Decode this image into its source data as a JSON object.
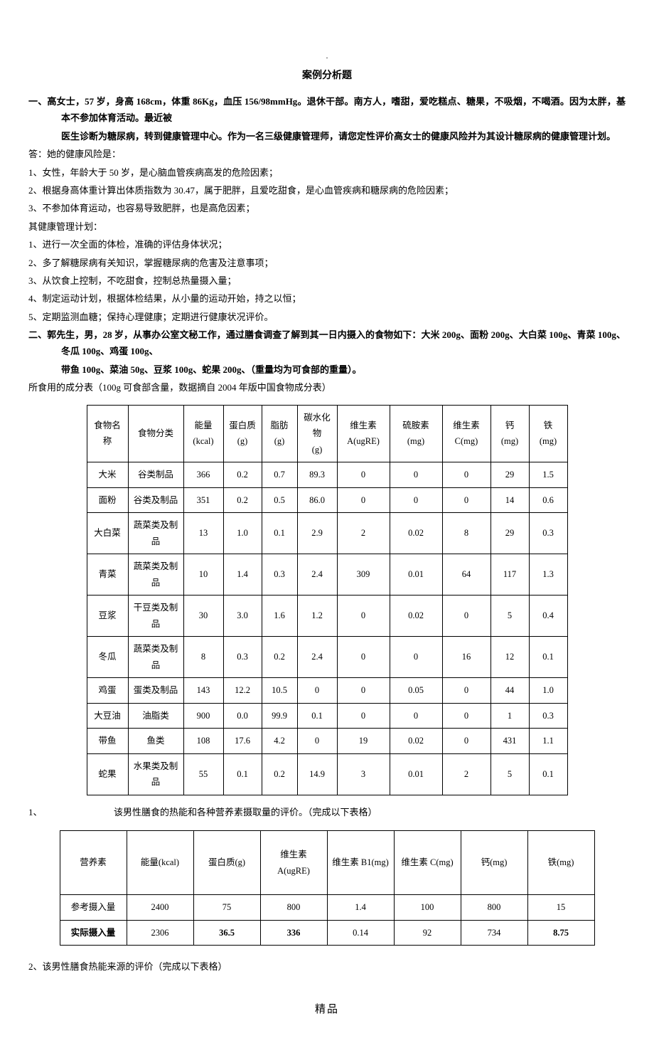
{
  "header_dot": ".",
  "title": "案例分析题",
  "q1": {
    "stem1": "一、高女士，57 岁，身高 168cm，体重 86Kg，血压 156/98mmHg。退休干部。南方人，嗜甜，爱吃糕点、糖果，不吸烟，不喝酒。因为太胖，基本不参加体育活动。最近被",
    "stem2": "医生诊断为糖尿病，转到健康管理中心。作为一名三级健康管理师，请您定性评价高女士的健康风险并为其设计糖尿病的健康管理计划。",
    "ans_label": "答：她的健康风险是：",
    "r1": "1、女性，年龄大于 50 岁，是心脑血管疾病高发的危险因素；",
    "r2": "2、根据身高体重计算出体质指数为 30.47，属于肥胖，且爱吃甜食，是心血管疾病和糖尿病的危险因素；",
    "r3": "3、不参加体育运动，也容易导致肥胖，也是高危因素；",
    "plan_label": "其健康管理计划：",
    "p1": "1、进行一次全面的体检，准确的评估身体状况；",
    "p2": "2、多了解糖尿病有关知识，掌握糖尿病的危害及注意事项；",
    "p3": "3、从饮食上控制，不吃甜食，控制总热量摄入量；",
    "p4": "4、制定运动计划，根据体检结果，从小量的运动开始，持之以恒；",
    "p5": "5、定期监测血糖；保持心理健康；定期进行健康状况评价。"
  },
  "q2": {
    "stem1": "二、郭先生，男，28 岁，从事办公室文秘工作，通过膳食调查了解到其一日内摄入的食物如下：大米 200g、面粉 200g、大白菜 100g、青菜 100g、冬瓜 100g、鸡蛋 100g、",
    "stem2": "带鱼 100g、菜油 50g、豆浆 100g、蛇果 200g、（重量均为可食部的重量）。",
    "note": "所食用的成分表（100g 可食部含量，数据摘自 2004 年版中国食物成分表）"
  },
  "t1": {
    "headers": [
      "食物名称",
      "食物分类",
      "能量\n(kcal)",
      "蛋白质(g)",
      "脂肪\n(g)",
      "碳水化物\n(g)",
      "维生素\nA(ugRE)",
      "硫胺素\n(mg)",
      "维生素\nC(mg)",
      "钙\n(mg)",
      "铁\n(mg)"
    ],
    "rows": [
      [
        "大米",
        "谷类制品",
        "366",
        "0.2",
        "0.7",
        "89.3",
        "0",
        "0",
        "0",
        "29",
        "1.5"
      ],
      [
        "面粉",
        "谷类及制品",
        "351",
        "0.2",
        "0.5",
        "86.0",
        "0",
        "0",
        "0",
        "14",
        "0.6"
      ],
      [
        "大白菜",
        "蔬菜类及制品",
        "13",
        "1.0",
        "0.1",
        "2.9",
        "2",
        "0.02",
        "8",
        "29",
        "0.3"
      ],
      [
        "青菜",
        "蔬菜类及制品",
        "10",
        "1.4",
        "0.3",
        "2.4",
        "309",
        "0.01",
        "64",
        "117",
        "1.3"
      ],
      [
        "豆浆",
        "干豆类及制品",
        "30",
        "3.0",
        "1.6",
        "1.2",
        "0",
        "0.02",
        "0",
        "5",
        "0.4"
      ],
      [
        "冬瓜",
        "蔬菜类及制品",
        "8",
        "0.3",
        "0.2",
        "2.4",
        "0",
        "0",
        "16",
        "12",
        "0.1"
      ],
      [
        "鸡蛋",
        "蛋类及制品",
        "143",
        "12.2",
        "10.5",
        "0",
        "0",
        "0.05",
        "0",
        "44",
        "1.0"
      ],
      [
        "大豆油",
        "油脂类",
        "900",
        "0.0",
        "99.9",
        "0.1",
        "0",
        "0",
        "0",
        "1",
        "0.3"
      ],
      [
        "带鱼",
        "鱼类",
        "108",
        "17.6",
        "4.2",
        "0",
        "19",
        "0.02",
        "0",
        "431",
        "1.1"
      ],
      [
        "蛇果",
        "水果类及制品",
        "55",
        "0.1",
        "0.2",
        "14.9",
        "3",
        "0.01",
        "2",
        "5",
        "0.1"
      ]
    ]
  },
  "sub1": {
    "num": "1、",
    "text": "该男性膳食的热能和各种营养素摄取量的评价。（完成以下表格）"
  },
  "t2": {
    "headers": [
      "营养素",
      "能量(kcal)",
      "蛋白质(g)",
      "维生素\nA(ugRE)",
      "维生素 B1(mg)",
      "维生素 C(mg)",
      "钙(mg)",
      "铁(mg)"
    ],
    "rows": [
      [
        "参考摄入量",
        "2400",
        "75",
        "800",
        "1.4",
        "100",
        "800",
        "15"
      ],
      [
        "实际摄入量",
        "2306",
        "36.5",
        "336",
        "0.14",
        "92",
        "734",
        "8.75"
      ]
    ]
  },
  "sub2": "2、该男性膳食热能来源的评价（完成以下表格）",
  "footer": "精品"
}
